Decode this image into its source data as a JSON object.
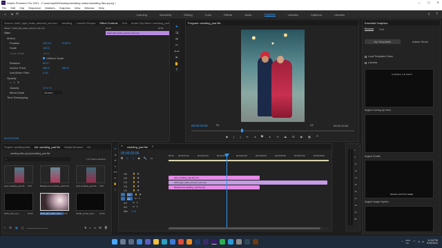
{
  "window": {
    "title": "Adobe Premiere Pro 2021 - C:\\users\\pd56\\Desktop\\wedding motion\\wedding files.prproj *",
    "min": "—",
    "max": "☐",
    "close": "✕"
  },
  "menu": [
    "File",
    "Edit",
    "Clip",
    "Sequence",
    "Markers",
    "Graphics",
    "View",
    "Window",
    "Help"
  ],
  "workspaces": [
    "Learning",
    "Assembly",
    "Editing",
    "Color",
    "Effects",
    "Audio",
    "Graphics",
    "Libraries",
    "Captions",
    "Libraries"
  ],
  "workspace_active": "Graphics",
  "source_panel": {
    "tabs": [
      "Source: 0x60_light_leaks_element_left.mov",
      "wedding_pad file: *0x60_light_leaks...",
      "Lumetri Scopes",
      "Effect Controls",
      "Text",
      "Audio Clip Mixer: wedding_pad"
    ],
    "master": "Master * 0x60_light_leaks_element_left.mov",
    "clip_label": "0x60_light_leaks_element_left.mov",
    "video_header": "Video",
    "times": [
      "00:00",
      "00:05"
    ],
    "props": [
      {
        "name": "Motion",
        "v1": "",
        "v2": ""
      },
      {
        "name": "Position",
        "v1": "1874.0",
        "v2": "5790.0"
      },
      {
        "name": "Scale",
        "v1": "100.0",
        "v2": ""
      },
      {
        "name": "Scale Width",
        "v1": "100.0",
        "v2": ""
      },
      {
        "name": "",
        "v1": "Uniform Scale",
        "v2": ""
      },
      {
        "name": "Rotation",
        "v1": "90.0 °",
        "v2": ""
      },
      {
        "name": "Anchor Point",
        "v1": "960.0",
        "v2": "540.0"
      },
      {
        "name": "Anti-flicker Filter",
        "v1": "0.00",
        "v2": ""
      },
      {
        "name": "Opacity",
        "v1": "",
        "v2": ""
      },
      {
        "name": "",
        "v1": "",
        "v2": ""
      },
      {
        "name": "Opacity",
        "v1": "47.0 %",
        "v2": ""
      },
      {
        "name": "Blend Mode",
        "v1": "Screen",
        "v2": ""
      },
      {
        "name": "Time Remapping",
        "v1": "",
        "v2": ""
      }
    ],
    "timecode": "00:00:03:06"
  },
  "program": {
    "tab": "Program: wedding_pad file",
    "timecode": "00:00:03:00",
    "fit": "Fit",
    "quality": "1/2",
    "duration": "00:00:10:00"
  },
  "essential": {
    "tabs": [
      "Browse",
      "Edit"
    ],
    "my_templates": "My Templates",
    "adobe_stock": "Adobe Stock",
    "local_templates": "Local Templates Folder",
    "libraries": "Libraries",
    "templates": [
      {
        "label": "Angled Coming Up Next",
        "overlay": "COMING UP NEXT"
      },
      {
        "label": "Angled Credits",
        "overlay": ""
      },
      {
        "label": "Angled Image Caption",
        "overlay": "IMAGE CAPTION HERE"
      },
      {
        "label": "",
        "overlay": ""
      }
    ]
  },
  "project": {
    "tabs": [
      "Project: wedding files",
      "bin: wedding_pad file",
      "Media Browser",
      "Lib"
    ],
    "path": "wedding files.prproj\\wedding_pad file",
    "count": "1 of 6 items selected",
    "items": [
      {
        "name": "save wedding_pad file",
        "dur": "5:00"
      },
      {
        "name": "Background wedding_pad...",
        "dur": "10:00"
      },
      {
        "name": "back wedding_pad file",
        "dur": "5:00"
      },
      {
        "name": "0x60_dust_one...",
        "dur": "10:00"
      },
      {
        "name": "0x60_light_leaks_elem...",
        "dur": "8:20"
      },
      {
        "name": "0x240_smoke_part...",
        "dur": "10:00"
      }
    ]
  },
  "timeline": {
    "tab": "wedding_pad file",
    "timecode": "00:00:03:06",
    "ruler": [
      "00:00",
      "00:00:01:00",
      "00:00:02:00",
      "00:00:03:00",
      "00:00:04:00",
      "00:00:05:00",
      "00:00:06:00",
      "00:00:07:00",
      "00:00:08:00",
      "00:00:09:00"
    ],
    "tracks": [
      "V6",
      "V5",
      "V4",
      "V3",
      "V2",
      "V1",
      "A1",
      "A2",
      "A3"
    ],
    "clips": [
      {
        "label": "save wedding_pad file.psd",
        "color": "#e58be6"
      },
      {
        "label": "0x60_light_leaks_element_left.mov",
        "color": "#c59be6"
      },
      {
        "label": "Background wedding_pad file.psd",
        "color": "#e58be6"
      }
    ],
    "master": "Mix",
    "master_value": "0.0"
  },
  "meter_labels": [
    "0",
    "-6",
    "-12",
    "-18",
    "-24",
    "-30",
    "-36",
    "-42",
    "-48",
    "-54",
    "dB"
  ],
  "taskbar": {
    "lang": "ENG\nUS",
    "time": "11:06 PM",
    "date": "8/25/2022"
  },
  "colors": {
    "accent": "#2f9bff",
    "clip_pink": "#e58be6",
    "clip_purple": "#c59be6",
    "playhead": "#2f9bff"
  }
}
